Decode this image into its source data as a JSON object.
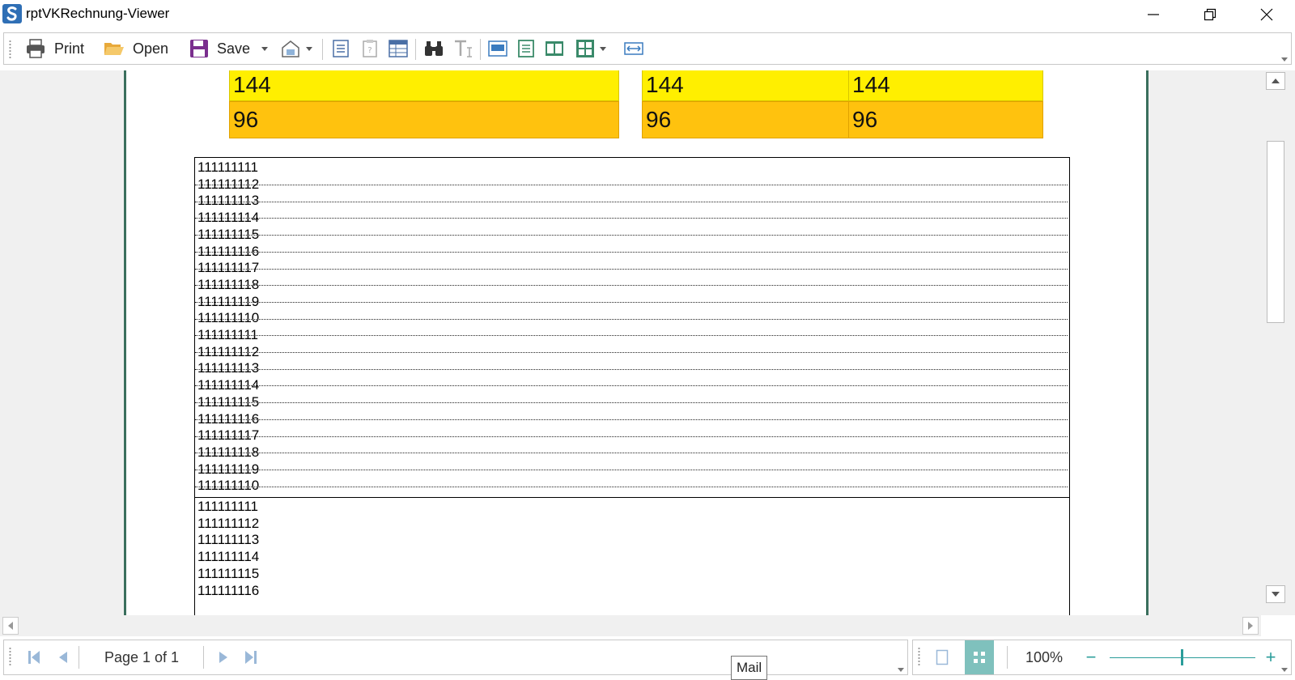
{
  "window": {
    "title": "rptVKRechnung-Viewer"
  },
  "toolbar": {
    "print_label": "Print",
    "open_label": "Open",
    "save_label": "Save"
  },
  "report": {
    "summary_cells": {
      "left_top": "144",
      "left_bottom": "96",
      "mid_top": "144",
      "mid_bottom": "96",
      "right_top": "144",
      "right_bottom": "96"
    },
    "list1": [
      "111111111",
      "111111112",
      "111111113",
      "111111114",
      "111111115",
      "111111116",
      "111111117",
      "111111118",
      "111111119",
      "111111110",
      "111111111",
      "111111112",
      "111111113",
      "111111114",
      "111111115",
      "111111116",
      "111111117",
      "111111118",
      "111111119",
      "111111110"
    ],
    "list2": [
      "111111111",
      "111111112",
      "111111113",
      "111111114",
      "111111115",
      "111111116"
    ]
  },
  "status": {
    "page_info": "Page 1 of 1",
    "zoom": "100%",
    "zoom_out": "−",
    "zoom_in": "+"
  },
  "tooltip": {
    "text": "Mail"
  },
  "colors": {
    "yellow": "#ffef00",
    "orange": "#ffc20e",
    "accent": "#2a9d9a",
    "page_border": "#3a6f5d"
  }
}
